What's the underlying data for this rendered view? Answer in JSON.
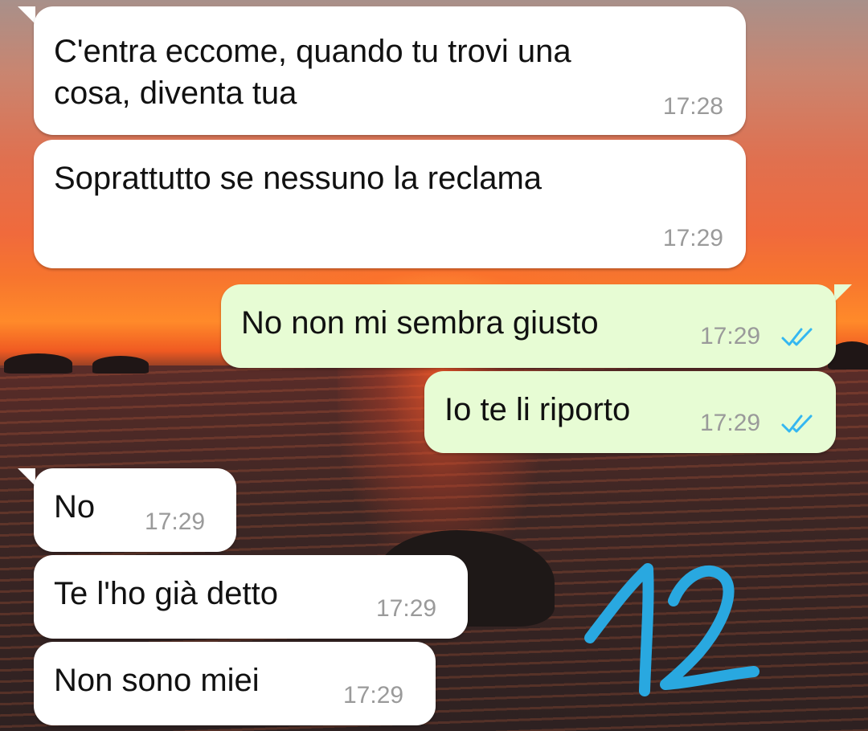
{
  "messages": [
    {
      "direction": "incoming",
      "text_line1": "C'entra eccome, quando tu trovi una",
      "text_line2": "cosa, diventa tua",
      "time": "17:28"
    },
    {
      "direction": "incoming",
      "text": "Soprattutto se nessuno la reclama",
      "time": "17:29"
    },
    {
      "direction": "outgoing",
      "text": "No non mi sembra giusto",
      "time": "17:29",
      "status": "read"
    },
    {
      "direction": "outgoing",
      "text": "Io te li riporto",
      "time": "17:29",
      "status": "read"
    },
    {
      "direction": "incoming",
      "text": "No",
      "time": "17:29"
    },
    {
      "direction": "incoming",
      "text": "Te l'ho già detto",
      "time": "17:29"
    },
    {
      "direction": "incoming",
      "text": "Non sono miei",
      "time": "17:29"
    }
  ],
  "annotation": {
    "text": "12",
    "color": "#29a8e0"
  },
  "colors": {
    "incoming_bubble": "#ffffff",
    "outgoing_bubble": "#e7fcd4",
    "read_ticks": "#34b7f1"
  },
  "icons": {
    "read_receipt": "double-check-icon"
  }
}
